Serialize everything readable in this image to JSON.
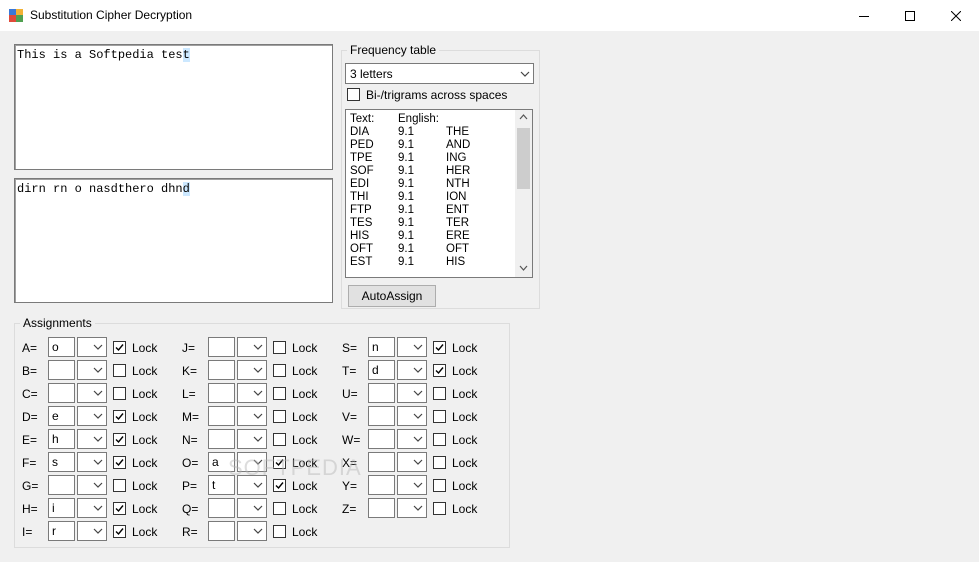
{
  "window": {
    "title": "Substitution Cipher Decryption"
  },
  "plaintext": {
    "before": "This is a Softpedia tes",
    "selected": "t"
  },
  "ciphertext": {
    "before": "dirn rn o nasdthero dhn",
    "selected": "d"
  },
  "frequency": {
    "group_label": "Frequency table",
    "combo_value": "3 letters",
    "checkbox_label": "Bi-/trigrams across spaces",
    "checkbox_checked": false,
    "header": {
      "text": "Text:",
      "english": "English:"
    },
    "rows": [
      {
        "text": "DIA",
        "value": "9.1",
        "english": "THE"
      },
      {
        "text": "PED",
        "value": "9.1",
        "english": "AND"
      },
      {
        "text": "TPE",
        "value": "9.1",
        "english": "ING"
      },
      {
        "text": "SOF",
        "value": "9.1",
        "english": "HER"
      },
      {
        "text": "EDI",
        "value": "9.1",
        "english": "NTH"
      },
      {
        "text": "THI",
        "value": "9.1",
        "english": "ION"
      },
      {
        "text": "FTP",
        "value": "9.1",
        "english": "ENT"
      },
      {
        "text": "TES",
        "value": "9.1",
        "english": "TER"
      },
      {
        "text": "HIS",
        "value": "9.1",
        "english": "ERE"
      },
      {
        "text": "OFT",
        "value": "9.1",
        "english": "OFT"
      },
      {
        "text": "EST",
        "value": "9.1",
        "english": "HIS"
      }
    ],
    "button_label": "AutoAssign"
  },
  "assignments": {
    "group_label": "Assignments",
    "lock_label": "Lock",
    "columns": [
      [
        {
          "label": "A=",
          "value": "o",
          "locked": true
        },
        {
          "label": "B=",
          "value": "",
          "locked": false
        },
        {
          "label": "C=",
          "value": "",
          "locked": false
        },
        {
          "label": "D=",
          "value": "e",
          "locked": true
        },
        {
          "label": "E=",
          "value": "h",
          "locked": true
        },
        {
          "label": "F=",
          "value": "s",
          "locked": true
        },
        {
          "label": "G=",
          "value": "",
          "locked": false
        },
        {
          "label": "H=",
          "value": "i",
          "locked": true
        },
        {
          "label": "I=",
          "value": "r",
          "locked": true
        }
      ],
      [
        {
          "label": "J=",
          "value": "",
          "locked": false
        },
        {
          "label": "K=",
          "value": "",
          "locked": false
        },
        {
          "label": "L=",
          "value": "",
          "locked": false
        },
        {
          "label": "M=",
          "value": "",
          "locked": false
        },
        {
          "label": "N=",
          "value": "",
          "locked": false
        },
        {
          "label": "O=",
          "value": "a",
          "locked": true
        },
        {
          "label": "P=",
          "value": "t",
          "locked": true
        },
        {
          "label": "Q=",
          "value": "",
          "locked": false
        },
        {
          "label": "R=",
          "value": "",
          "locked": false
        }
      ],
      [
        {
          "label": "S=",
          "value": "n",
          "locked": true
        },
        {
          "label": "T=",
          "value": "d",
          "locked": true
        },
        {
          "label": "U=",
          "value": "",
          "locked": false
        },
        {
          "label": "V=",
          "value": "",
          "locked": false
        },
        {
          "label": "W=",
          "value": "",
          "locked": false
        },
        {
          "label": "X=",
          "value": "",
          "locked": false
        },
        {
          "label": "Y=",
          "value": "",
          "locked": false
        },
        {
          "label": "Z=",
          "value": "",
          "locked": false
        }
      ]
    ]
  },
  "watermark": "SOFTPEDIA"
}
